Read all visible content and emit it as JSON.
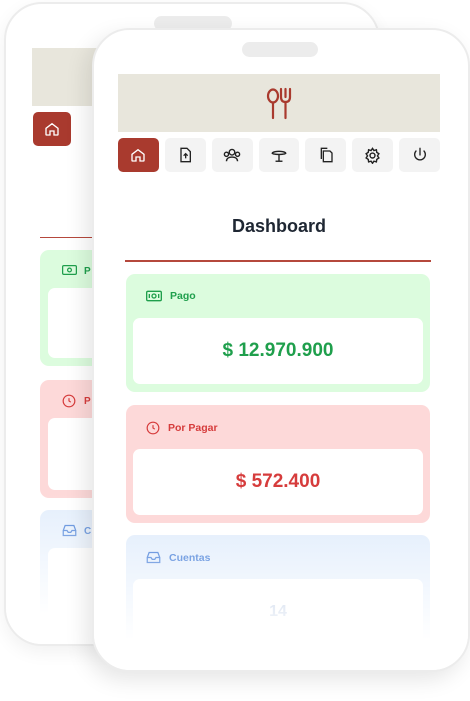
{
  "dashboard": {
    "title": "Dashboard",
    "cards": [
      {
        "label": "Pago",
        "value": "$ 12.970.900",
        "icon": "cash-icon"
      },
      {
        "label": "Por Pagar",
        "value": "$ 572.400",
        "icon": "clock-icon"
      },
      {
        "label": "Cuentas",
        "value": "14",
        "icon": "inbox-icon"
      }
    ]
  },
  "back_preview": {
    "cards": [
      {
        "label": "P"
      },
      {
        "label": "P"
      },
      {
        "label": "C"
      }
    ]
  },
  "nav": [
    "home-icon",
    "upload-icon",
    "users-icon",
    "serving-icon",
    "documents-icon",
    "settings-icon",
    "power-icon"
  ],
  "colors": {
    "brand": "#a93a2e",
    "banner": "#e8e6dc",
    "paid": "#1f9f4c",
    "due": "#d63c3c",
    "accounts": "#3d78d6"
  }
}
